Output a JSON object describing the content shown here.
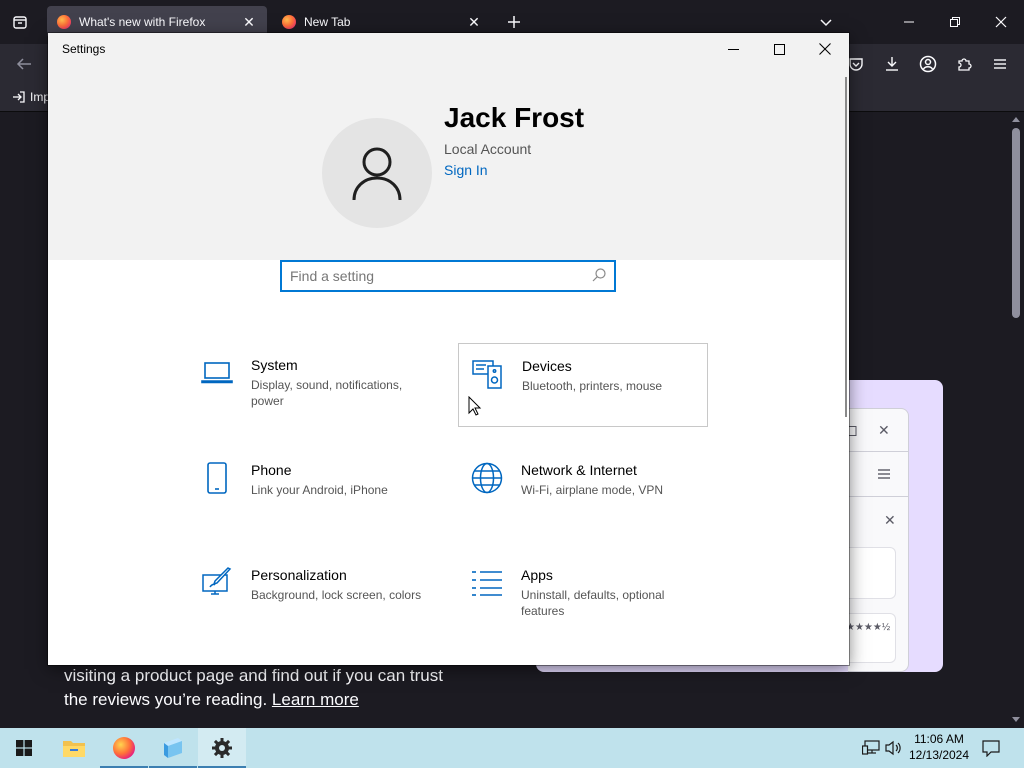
{
  "firefox": {
    "tabs": [
      {
        "title": "What's new with Firefox",
        "active": true
      },
      {
        "title": "New Tab",
        "active": false
      }
    ],
    "bookmark_label": "Imp",
    "promo": {
      "line1": "visiting a product page and find out if you can trust",
      "line2_prefix": "the reviews you’re reading.",
      "link": "Learn more",
      "rating": "★★★★½"
    }
  },
  "settings": {
    "title": "Settings",
    "user": {
      "name": "Jack Frost",
      "account_type": "Local Account",
      "sign_in": "Sign In"
    },
    "search": {
      "value": "",
      "placeholder": "Find a setting"
    },
    "categories": [
      {
        "name": "System",
        "desc": "Display, sound, notifications, power",
        "icon": "laptop-icon"
      },
      {
        "name": "Devices",
        "desc": "Bluetooth, printers, mouse",
        "icon": "devices-icon"
      },
      {
        "name": "Phone",
        "desc": "Link your Android, iPhone",
        "icon": "phone-icon"
      },
      {
        "name": "Network & Internet",
        "desc": "Wi-Fi, airplane mode, VPN",
        "icon": "globe-icon"
      },
      {
        "name": "Personalization",
        "desc": "Background, lock screen, colors",
        "icon": "paint-icon"
      },
      {
        "name": "Apps",
        "desc": "Uninstall, defaults, optional features",
        "icon": "apps-list-icon"
      }
    ],
    "accent_color": "#0067c0"
  },
  "taskbar": {
    "time": "11:06 AM",
    "date": "12/13/2024",
    "apps": [
      "start",
      "file-explorer",
      "firefox",
      "app-installer",
      "settings"
    ]
  }
}
